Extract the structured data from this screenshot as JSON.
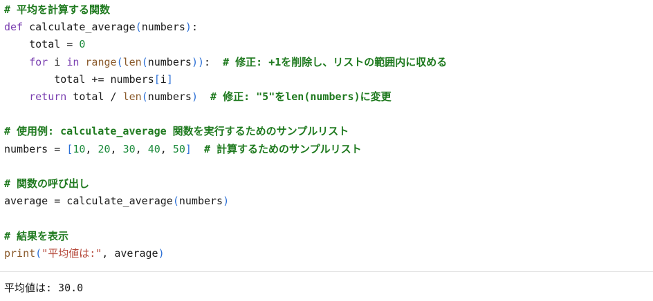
{
  "code": {
    "lines": [
      [
        {
          "t": "# 平均を計算する関数",
          "c": "comment"
        }
      ],
      [
        {
          "t": "def",
          "c": "keyword"
        },
        {
          "t": " calculate_average",
          "c": "plain"
        },
        {
          "t": "(",
          "c": "bracket"
        },
        {
          "t": "numbers",
          "c": "plain"
        },
        {
          "t": ")",
          "c": "bracket"
        },
        {
          "t": ":",
          "c": "plain"
        }
      ],
      [
        {
          "t": "    total = ",
          "c": "plain"
        },
        {
          "t": "0",
          "c": "number"
        }
      ],
      [
        {
          "t": "    ",
          "c": "plain"
        },
        {
          "t": "for",
          "c": "keyword"
        },
        {
          "t": " i ",
          "c": "plain"
        },
        {
          "t": "in",
          "c": "keyword"
        },
        {
          "t": " ",
          "c": "plain"
        },
        {
          "t": "range",
          "c": "builtin"
        },
        {
          "t": "(",
          "c": "bracket"
        },
        {
          "t": "len",
          "c": "builtin"
        },
        {
          "t": "(",
          "c": "bracket"
        },
        {
          "t": "numbers",
          "c": "plain"
        },
        {
          "t": "))",
          "c": "bracket"
        },
        {
          "t": ":  ",
          "c": "plain"
        },
        {
          "t": "# 修正: +1を削除し、リストの範囲内に収める",
          "c": "comment"
        }
      ],
      [
        {
          "t": "        total += numbers",
          "c": "plain"
        },
        {
          "t": "[",
          "c": "bracket"
        },
        {
          "t": "i",
          "c": "plain"
        },
        {
          "t": "]",
          "c": "bracket"
        }
      ],
      [
        {
          "t": "    ",
          "c": "plain"
        },
        {
          "t": "return",
          "c": "keyword"
        },
        {
          "t": " total / ",
          "c": "plain"
        },
        {
          "t": "len",
          "c": "builtin"
        },
        {
          "t": "(",
          "c": "bracket"
        },
        {
          "t": "numbers",
          "c": "plain"
        },
        {
          "t": ")",
          "c": "bracket"
        },
        {
          "t": "  ",
          "c": "plain"
        },
        {
          "t": "# 修正: \"5\"をlen(numbers)に変更",
          "c": "comment"
        }
      ],
      [],
      [
        {
          "t": "# 使用例: calculate_average 関数を実行するためのサンプルリスト",
          "c": "comment"
        }
      ],
      [
        {
          "t": "numbers = ",
          "c": "plain"
        },
        {
          "t": "[",
          "c": "bracket"
        },
        {
          "t": "10",
          "c": "number"
        },
        {
          "t": ", ",
          "c": "plain"
        },
        {
          "t": "20",
          "c": "number"
        },
        {
          "t": ", ",
          "c": "plain"
        },
        {
          "t": "30",
          "c": "number"
        },
        {
          "t": ", ",
          "c": "plain"
        },
        {
          "t": "40",
          "c": "number"
        },
        {
          "t": ", ",
          "c": "plain"
        },
        {
          "t": "50",
          "c": "number"
        },
        {
          "t": "]",
          "c": "bracket"
        },
        {
          "t": "  ",
          "c": "plain"
        },
        {
          "t": "# 計算するためのサンプルリスト",
          "c": "comment"
        }
      ],
      [],
      [
        {
          "t": "# 関数の呼び出し",
          "c": "comment"
        }
      ],
      [
        {
          "t": "average = calculate_average",
          "c": "plain"
        },
        {
          "t": "(",
          "c": "bracket"
        },
        {
          "t": "numbers",
          "c": "plain"
        },
        {
          "t": ")",
          "c": "bracket"
        }
      ],
      [],
      [
        {
          "t": "# 結果を表示",
          "c": "comment"
        }
      ],
      [
        {
          "t": "print",
          "c": "builtin"
        },
        {
          "t": "(",
          "c": "bracket"
        },
        {
          "t": "\"平均値は:\"",
          "c": "string"
        },
        {
          "t": ", average",
          "c": "plain"
        },
        {
          "t": ")",
          "c": "bracket"
        }
      ]
    ]
  },
  "output": {
    "text": "平均値は: 30.0"
  },
  "colors": {
    "comment": "#1f7a1f",
    "keyword": "#7a3fb0",
    "builtin": "#8a5a2b",
    "number": "#1a8a3a",
    "string": "#b5483a",
    "bracket": "#2b6fd6",
    "text": "#1a1a1a"
  }
}
